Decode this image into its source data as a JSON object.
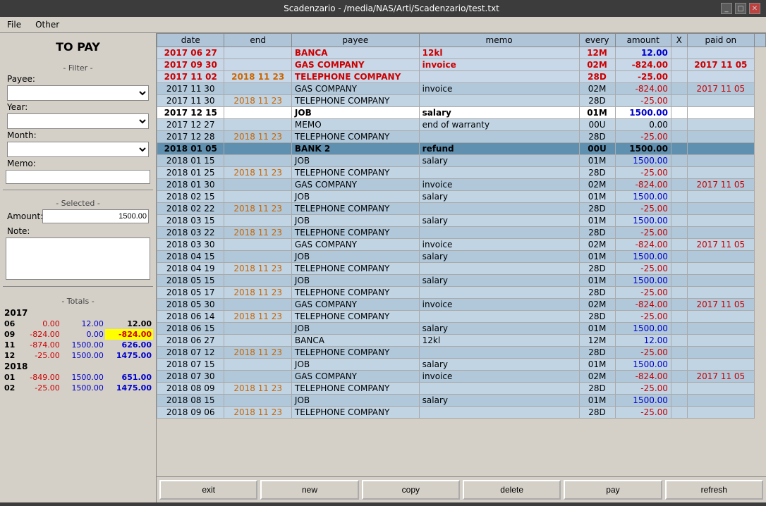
{
  "window": {
    "title": "Scadenzario - /media/NAS/Arti/Scadenzario/test.txt",
    "controls": [
      "_",
      "□",
      "✕"
    ]
  },
  "menu": {
    "items": [
      "File",
      "Other"
    ]
  },
  "left_panel": {
    "title": "TO PAY",
    "filter_label": "- Filter -",
    "payee_label": "Payee:",
    "year_label": "Year:",
    "month_label": "Month:",
    "memo_label": "Memo:",
    "selected_label": "- Selected -",
    "amount_label": "Amount:",
    "note_label": "Note:",
    "totals_label": "- Totals -",
    "amount_value": "1500.00",
    "payee_options": [
      ""
    ],
    "year_options": [
      ""
    ],
    "month_options": [
      ""
    ]
  },
  "totals": {
    "years": [
      {
        "year": "2017",
        "months": [
          {
            "month": "06",
            "col1": "0.00",
            "col2": "12.00",
            "col3": "12.00",
            "col1_color": "red",
            "col2_color": "blue",
            "col3_color": "black"
          },
          {
            "month": "09",
            "col1": "-824.00",
            "col2": "0.00",
            "col3": "-824.00",
            "col1_color": "red",
            "col2_color": "blue",
            "col3_color": "yellow_bg"
          },
          {
            "month": "11",
            "col1": "-874.00",
            "col2": "1500.00",
            "col3": "626.00",
            "col1_color": "red",
            "col2_color": "blue",
            "col3_color": "blue"
          },
          {
            "month": "12",
            "col1": "-25.00",
            "col2": "1500.00",
            "col3": "1475.00",
            "col1_color": "red",
            "col2_color": "blue",
            "col3_color": "blue"
          }
        ]
      },
      {
        "year": "2018",
        "months": [
          {
            "month": "01",
            "col1": "-849.00",
            "col2": "1500.00",
            "col3": "651.00",
            "col1_color": "red",
            "col2_color": "blue",
            "col3_color": "blue"
          },
          {
            "month": "02",
            "col1": "-25.00",
            "col2": "1500.00",
            "col3": "1475.00",
            "col1_color": "red",
            "col2_color": "blue",
            "col3_color": "blue"
          }
        ]
      }
    ]
  },
  "table": {
    "headers": [
      "date",
      "end",
      "payee",
      "memo",
      "every",
      "amount",
      "X",
      "paid on"
    ],
    "rows": [
      {
        "date": "2017 06 27",
        "end": "",
        "payee": "BANCA",
        "memo": "12kl",
        "every": "12M",
        "amount": "12.00",
        "x": "",
        "paid_on": "",
        "row_style": "highlight_red",
        "is_selected": false
      },
      {
        "date": "2017 09 30",
        "end": "",
        "payee": "GAS COMPANY",
        "memo": "invoice",
        "every": "02M",
        "amount": "-824.00",
        "x": "",
        "paid_on": "2017 11 05",
        "row_style": "highlight_red",
        "is_selected": false
      },
      {
        "date": "2017 11 02",
        "end": "2018 11 23",
        "payee": "TELEPHONE COMPANY",
        "memo": "",
        "every": "28D",
        "amount": "-25.00",
        "x": "",
        "paid_on": "",
        "row_style": "highlight_red",
        "is_selected": false
      },
      {
        "date": "2017 11 30",
        "end": "",
        "payee": "GAS COMPANY",
        "memo": "invoice",
        "every": "02M",
        "amount": "-824.00",
        "x": "",
        "paid_on": "2017 11 05",
        "row_style": "light",
        "is_selected": false
      },
      {
        "date": "2017 11 30",
        "end": "2018 11 23",
        "payee": "TELEPHONE COMPANY",
        "memo": "",
        "every": "28D",
        "amount": "-25.00",
        "x": "",
        "paid_on": "",
        "row_style": "light",
        "is_selected": false
      },
      {
        "date": "2017 12 15",
        "end": "",
        "payee": "JOB",
        "memo": "salary",
        "every": "01M",
        "amount": "1500.00",
        "x": "",
        "paid_on": "",
        "row_style": "white_bold",
        "is_selected": false
      },
      {
        "date": "2017 12 27",
        "end": "",
        "payee": "MEMO",
        "memo": "end of warranty",
        "every": "00U",
        "amount": "0.00",
        "x": "",
        "paid_on": "",
        "row_style": "light",
        "is_selected": false
      },
      {
        "date": "2017 12 28",
        "end": "2018 11 23",
        "payee": "TELEPHONE COMPANY",
        "memo": "",
        "every": "28D",
        "amount": "-25.00",
        "x": "",
        "paid_on": "",
        "row_style": "light",
        "is_selected": false
      },
      {
        "date": "2018 01 05",
        "end": "",
        "payee": "BANK 2",
        "memo": "refund",
        "every": "00U",
        "amount": "1500.00",
        "x": "",
        "paid_on": "",
        "row_style": "selected",
        "is_selected": true
      },
      {
        "date": "2018 01 15",
        "end": "",
        "payee": "JOB",
        "memo": "salary",
        "every": "01M",
        "amount": "1500.00",
        "x": "",
        "paid_on": "",
        "row_style": "light",
        "is_selected": false
      },
      {
        "date": "2018 01 25",
        "end": "2018 11 23",
        "payee": "TELEPHONE COMPANY",
        "memo": "",
        "every": "28D",
        "amount": "-25.00",
        "x": "",
        "paid_on": "",
        "row_style": "light",
        "is_selected": false
      },
      {
        "date": "2018 01 30",
        "end": "",
        "payee": "GAS COMPANY",
        "memo": "invoice",
        "every": "02M",
        "amount": "-824.00",
        "x": "",
        "paid_on": "2017 11 05",
        "row_style": "light",
        "is_selected": false
      },
      {
        "date": "2018 02 15",
        "end": "",
        "payee": "JOB",
        "memo": "salary",
        "every": "01M",
        "amount": "1500.00",
        "x": "",
        "paid_on": "",
        "row_style": "light",
        "is_selected": false
      },
      {
        "date": "2018 02 22",
        "end": "2018 11 23",
        "payee": "TELEPHONE COMPANY",
        "memo": "",
        "every": "28D",
        "amount": "-25.00",
        "x": "",
        "paid_on": "",
        "row_style": "light",
        "is_selected": false
      },
      {
        "date": "2018 03 15",
        "end": "",
        "payee": "JOB",
        "memo": "salary",
        "every": "01M",
        "amount": "1500.00",
        "x": "",
        "paid_on": "",
        "row_style": "light",
        "is_selected": false
      },
      {
        "date": "2018 03 22",
        "end": "2018 11 23",
        "payee": "TELEPHONE COMPANY",
        "memo": "",
        "every": "28D",
        "amount": "-25.00",
        "x": "",
        "paid_on": "",
        "row_style": "light",
        "is_selected": false
      },
      {
        "date": "2018 03 30",
        "end": "",
        "payee": "GAS COMPANY",
        "memo": "invoice",
        "every": "02M",
        "amount": "-824.00",
        "x": "",
        "paid_on": "2017 11 05",
        "row_style": "light",
        "is_selected": false
      },
      {
        "date": "2018 04 15",
        "end": "",
        "payee": "JOB",
        "memo": "salary",
        "every": "01M",
        "amount": "1500.00",
        "x": "",
        "paid_on": "",
        "row_style": "light",
        "is_selected": false
      },
      {
        "date": "2018 04 19",
        "end": "2018 11 23",
        "payee": "TELEPHONE COMPANY",
        "memo": "",
        "every": "28D",
        "amount": "-25.00",
        "x": "",
        "paid_on": "",
        "row_style": "light",
        "is_selected": false
      },
      {
        "date": "2018 05 15",
        "end": "",
        "payee": "JOB",
        "memo": "salary",
        "every": "01M",
        "amount": "1500.00",
        "x": "",
        "paid_on": "",
        "row_style": "light",
        "is_selected": false
      },
      {
        "date": "2018 05 17",
        "end": "2018 11 23",
        "payee": "TELEPHONE COMPANY",
        "memo": "",
        "every": "28D",
        "amount": "-25.00",
        "x": "",
        "paid_on": "",
        "row_style": "light",
        "is_selected": false
      },
      {
        "date": "2018 05 30",
        "end": "",
        "payee": "GAS COMPANY",
        "memo": "invoice",
        "every": "02M",
        "amount": "-824.00",
        "x": "",
        "paid_on": "2017 11 05",
        "row_style": "light",
        "is_selected": false
      },
      {
        "date": "2018 06 14",
        "end": "2018 11 23",
        "payee": "TELEPHONE COMPANY",
        "memo": "",
        "every": "28D",
        "amount": "-25.00",
        "x": "",
        "paid_on": "",
        "row_style": "light",
        "is_selected": false
      },
      {
        "date": "2018 06 15",
        "end": "",
        "payee": "JOB",
        "memo": "salary",
        "every": "01M",
        "amount": "1500.00",
        "x": "",
        "paid_on": "",
        "row_style": "light",
        "is_selected": false
      },
      {
        "date": "2018 06 27",
        "end": "",
        "payee": "BANCA",
        "memo": "12kl",
        "every": "12M",
        "amount": "12.00",
        "x": "",
        "paid_on": "",
        "row_style": "light",
        "is_selected": false
      },
      {
        "date": "2018 07 12",
        "end": "2018 11 23",
        "payee": "TELEPHONE COMPANY",
        "memo": "",
        "every": "28D",
        "amount": "-25.00",
        "x": "",
        "paid_on": "",
        "row_style": "light",
        "is_selected": false
      },
      {
        "date": "2018 07 15",
        "end": "",
        "payee": "JOB",
        "memo": "salary",
        "every": "01M",
        "amount": "1500.00",
        "x": "",
        "paid_on": "",
        "row_style": "light",
        "is_selected": false
      },
      {
        "date": "2018 07 30",
        "end": "",
        "payee": "GAS COMPANY",
        "memo": "invoice",
        "every": "02M",
        "amount": "-824.00",
        "x": "",
        "paid_on": "2017 11 05",
        "row_style": "light",
        "is_selected": false
      },
      {
        "date": "2018 08 09",
        "end": "2018 11 23",
        "payee": "TELEPHONE COMPANY",
        "memo": "",
        "every": "28D",
        "amount": "-25.00",
        "x": "",
        "paid_on": "",
        "row_style": "light",
        "is_selected": false
      },
      {
        "date": "2018 08 15",
        "end": "",
        "payee": "JOB",
        "memo": "salary",
        "every": "01M",
        "amount": "1500.00",
        "x": "",
        "paid_on": "",
        "row_style": "light",
        "is_selected": false
      },
      {
        "date": "2018 09 06",
        "end": "2018 11 23",
        "payee": "TELEPHONE COMPANY",
        "memo": "",
        "every": "28D",
        "amount": "-25.00",
        "x": "",
        "paid_on": "",
        "row_style": "light",
        "is_selected": false
      }
    ]
  },
  "buttons": {
    "exit": "exit",
    "new": "new",
    "copy": "copy",
    "delete": "delete",
    "pay": "pay",
    "refresh": "refresh"
  }
}
